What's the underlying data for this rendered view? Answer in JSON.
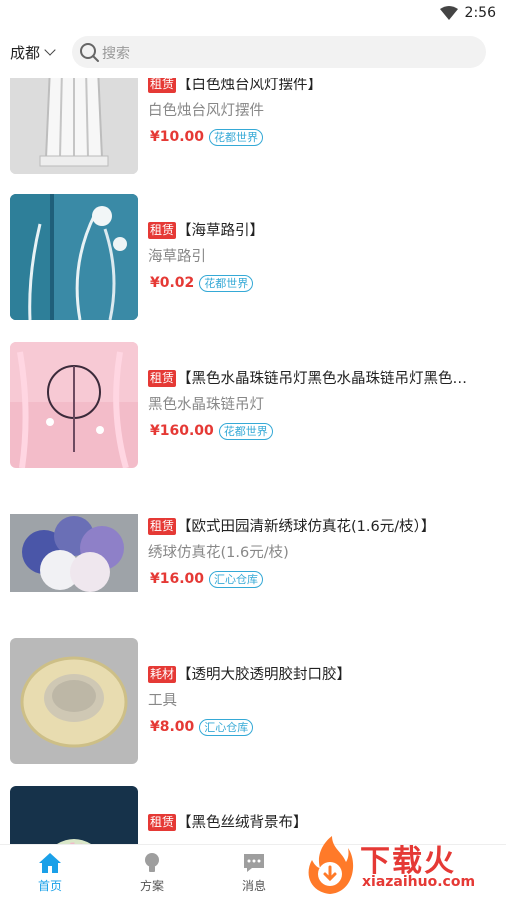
{
  "status_bar": {
    "time": "2:56"
  },
  "header": {
    "city": "成都",
    "search_placeholder": "搜索"
  },
  "products": [
    {
      "tag": "租赁",
      "title": "【白色烛台风灯摆件】",
      "subtitle": "白色烛台风灯摆件",
      "price": "¥10.00",
      "shop": "花都世界"
    },
    {
      "tag": "租赁",
      "title": "【海草路引】",
      "subtitle": "海草路引",
      "price": "¥0.02",
      "shop": "花都世界"
    },
    {
      "tag": "租赁",
      "title": "【黑色水晶珠链吊灯黑色水晶珠链吊灯黑色…",
      "subtitle": "黑色水晶珠链吊灯",
      "price": "¥160.00",
      "shop": "花都世界"
    },
    {
      "tag": "租赁",
      "title": "【欧式田园清新绣球仿真花(1.6元/枝）】",
      "subtitle": "绣球仿真花(1.6元/枝)",
      "price": "¥16.00",
      "shop": "汇心仓库"
    },
    {
      "tag": "耗材",
      "title": "【透明大胶透明胶封口胶】",
      "subtitle": "工具",
      "price": "¥8.00",
      "shop": "汇心仓库"
    },
    {
      "tag": "租赁",
      "title": "【黑色丝绒背景布】",
      "subtitle": "",
      "price": "",
      "shop": ""
    }
  ],
  "tabs": [
    {
      "label": "首页",
      "icon": "home-icon",
      "active": true
    },
    {
      "label": "方案",
      "icon": "lightbulb-icon",
      "active": false
    },
    {
      "label": "消息",
      "icon": "message-icon",
      "active": false
    }
  ],
  "watermark": {
    "text": "下载火",
    "url": "xiazaihuo.com"
  },
  "colors": {
    "price_red": "#e53935",
    "accent_blue": "#1aa0e8",
    "shop_border": "#35a9d6"
  }
}
